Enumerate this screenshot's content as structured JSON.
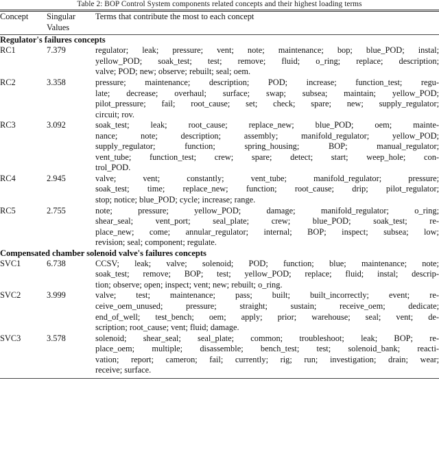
{
  "caption": "Table 2: BOP Control System components related concepts and their highest loading terms",
  "columns": {
    "concept": "Concept",
    "singular_values_line1": "Singular",
    "singular_values_line2": "Values",
    "terms": "Terms that contribute the most to each concept"
  },
  "sections": [
    {
      "title": "Regulator's failures concepts",
      "rows": [
        {
          "concept": "RC1",
          "singular_value": "7.379",
          "lines": [
            "regulator; leak; pressure; vent; note; maintenance; bop; blue_POD; instal;",
            "yellow_POD; soak_test; test; remove; fluid; o_ring; replace; description;",
            "valve; POD; new; observe; rebuilt; seal; oem."
          ]
        },
        {
          "concept": "RC2",
          "singular_value": "3.358",
          "lines": [
            "pressure; maintenance; description; POD; increase; function_test; regu-",
            "late; decrease; overhaul; surface; swap; subsea; maintain; yellow_POD;",
            "pilot_pressure; fail; root_cause; set; check; spare; new; supply_regulator;",
            "circuit; rov."
          ]
        },
        {
          "concept": "RC3",
          "singular_value": "3.092",
          "lines": [
            "soak_test; leak; root_cause; replace_new; blue_POD; oem; mainte-",
            "nance; note; description; assembly; manifold_regulator; yellow_POD;",
            "supply_regulator; function; spring_housing; BOP; manual_regulator;",
            "vent_tube; function_test; crew; spare; detect; start; weep_hole; con-",
            "trol_POD."
          ]
        },
        {
          "concept": "RC4",
          "singular_value": "2.945",
          "lines": [
            "valve; vent; constantly; vent_tube; manifold_regulator; pressure;",
            "soak_test; time; replace_new; function; root_cause; drip; pilot_regulator;",
            "stop; notice; blue_POD; cycle; increase; range."
          ]
        },
        {
          "concept": "RC5",
          "singular_value": "2.755",
          "lines": [
            "note; pressure; yellow_POD; damage; manifold_regulator; o_ring;",
            "shear_seal; vent_port; seal_plate; crew; blue_POD; soak_test; re-",
            "place_new; come; annular_regulator; internal; BOP; inspect; subsea; low;",
            "revision; seal; component; regulate."
          ]
        }
      ]
    },
    {
      "title": "Compensated chamber solenoid valve's failures concepts",
      "rows": [
        {
          "concept": "SVC1",
          "singular_value": "6.738",
          "lines": [
            "CCSV; leak; valve; solenoid; POD; function; blue; maintenance; note;",
            "soak_test; remove; BOP; test; yellow_POD; replace; fluid; instal; descrip-",
            "tion; observe; open; inspect; vent; new; rebuilt; o_ring."
          ]
        },
        {
          "concept": "SVC2",
          "singular_value": "3.999",
          "lines": [
            "valve; test; maintenance; pass; built; built_incorrectly; event; re-",
            "ceive_oem_unused; pressure; straight; sustain; receive_oem; dedicate;",
            "end_of_well; test_bench; oem; apply; prior; warehouse; seal; vent; de-",
            "scription; root_cause; vent; fluid; damage."
          ]
        },
        {
          "concept": "SVC3",
          "singular_value": "3.578",
          "lines": [
            "solenoid; shear_seal; seal_plate; common; troubleshoot; leak; BOP; re-",
            "place_oem; multiple; disassemble; bench_test; test; solenoid_bank; reacti-",
            "vation; report; cameron; fail; currently; rig; run; investigation; drain; wear;",
            "receive; surface."
          ]
        }
      ]
    }
  ]
}
